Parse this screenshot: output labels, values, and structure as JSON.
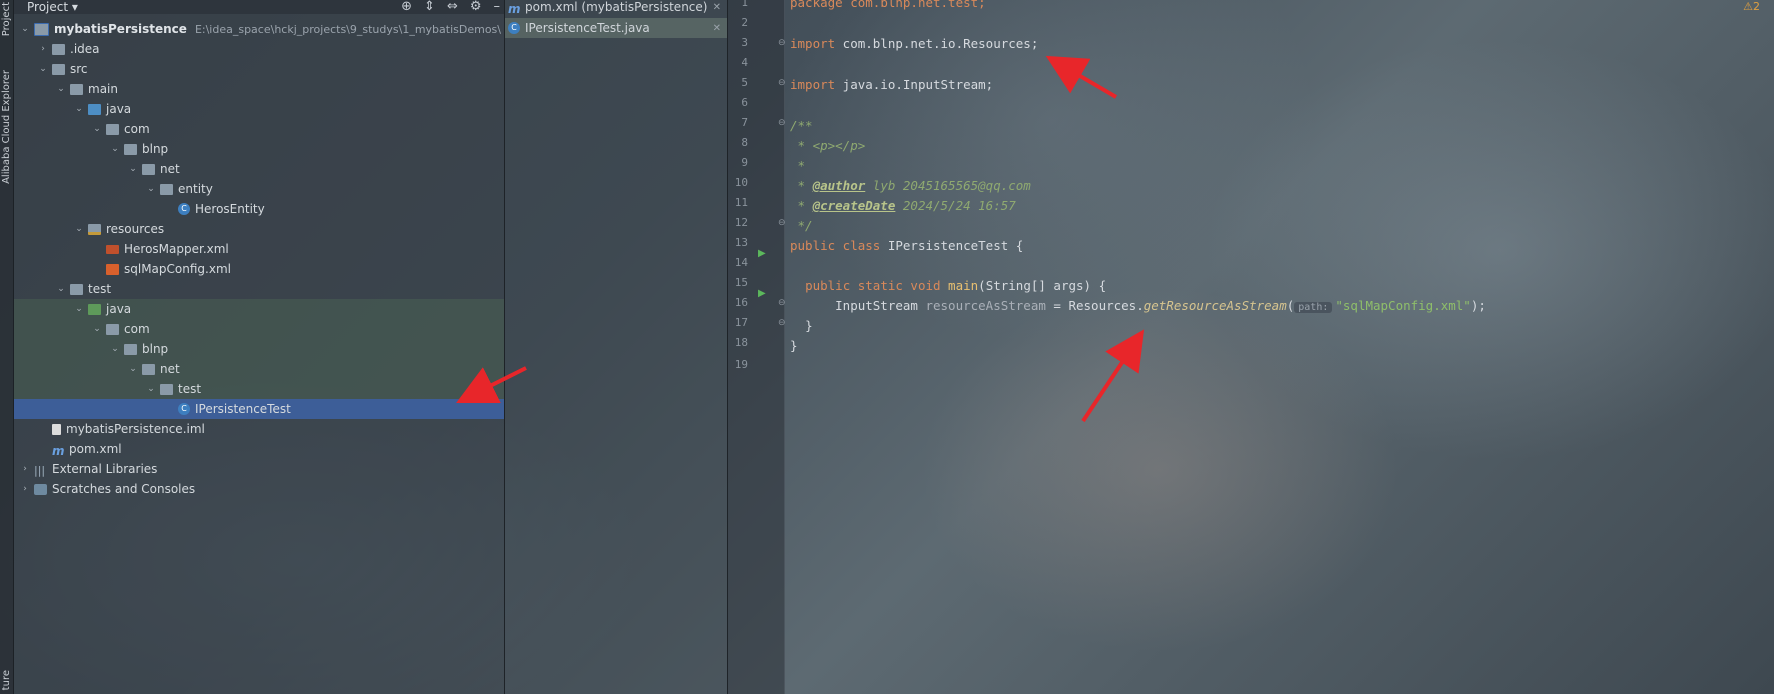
{
  "toolstrip": {
    "project_label": "Project",
    "cloud_label": "Alibaba Cloud Explorer",
    "structure_label": "ture"
  },
  "project_panel": {
    "title": "Project",
    "tree": [
      {
        "label": "mybatisPersistence",
        "hint": "E:\\idea_space\\hckj_projects\\9_studys\\1_mybatisDemos\\",
        "icon": "module-folder-icon",
        "expanded": true
      },
      {
        "label": ".idea",
        "icon": "folder-icon",
        "expanded": false
      },
      {
        "label": "src",
        "icon": "folder-icon",
        "expanded": true
      },
      {
        "label": "main",
        "icon": "folder-icon",
        "expanded": true
      },
      {
        "label": "java",
        "icon": "source-folder-icon",
        "expanded": true
      },
      {
        "label": "com",
        "icon": "package-icon",
        "expanded": true
      },
      {
        "label": "blnp",
        "icon": "package-icon",
        "expanded": true
      },
      {
        "label": "net",
        "icon": "package-icon",
        "expanded": true
      },
      {
        "label": "entity",
        "icon": "package-icon",
        "expanded": true
      },
      {
        "label": "HerosEntity",
        "icon": "class-icon"
      },
      {
        "label": "resources",
        "icon": "resources-folder-icon",
        "expanded": true
      },
      {
        "label": "HerosMapper.xml",
        "icon": "mybatis-xml-icon"
      },
      {
        "label": "sqlMapConfig.xml",
        "icon": "xml-file-icon"
      },
      {
        "label": "test",
        "icon": "folder-icon",
        "expanded": true
      },
      {
        "label": "java",
        "icon": "test-source-folder-icon",
        "expanded": true
      },
      {
        "label": "com",
        "icon": "package-icon",
        "expanded": true
      },
      {
        "label": "blnp",
        "icon": "package-icon",
        "expanded": true
      },
      {
        "label": "net",
        "icon": "package-icon",
        "expanded": true
      },
      {
        "label": "test",
        "icon": "package-icon",
        "expanded": true
      },
      {
        "label": "IPersistenceTest",
        "icon": "class-icon",
        "selected": true
      },
      {
        "label": "mybatisPersistence.iml",
        "icon": "iml-file-icon"
      },
      {
        "label": "pom.xml",
        "icon": "maven-icon"
      },
      {
        "label": "External Libraries",
        "icon": "library-icon",
        "expanded": false
      },
      {
        "label": "Scratches and Consoles",
        "icon": "scratch-icon",
        "expanded": false
      }
    ]
  },
  "open_files": [
    {
      "label": "pom.xml (mybatisPersistence)",
      "icon": "maven-icon"
    },
    {
      "label": "IPersistenceTest.java",
      "icon": "class-icon",
      "active": true
    }
  ],
  "editor": {
    "warnings": "2",
    "lines": [
      "1",
      "2",
      "3",
      "4",
      "5",
      "6",
      "7",
      "8",
      "9",
      "10",
      "11",
      "12",
      "13",
      "14",
      "15",
      "16",
      "17",
      "18",
      "19"
    ],
    "code": {
      "l1_kw": "package",
      "l1_rest": " com.blnp.net.test;",
      "l3_kw": "import",
      "l3_rest": " com.blnp.net.io.Resources;",
      "l5_kw": "import",
      "l5_rest": " java.io.InputStream;",
      "l7": "/**",
      "l8_star": " * ",
      "l8_text": "<p></p>",
      "l9": " *",
      "l10_star": " * ",
      "l10_tag": "@author",
      "l10_text": " lyb 2045165565@qq.com",
      "l11_star": " * ",
      "l11_tag": "@createDate",
      "l11_text": " 2024/5/24 16:57",
      "l12": " */",
      "l13_kw": "public class",
      "l13_rest": " IPersistenceTest {",
      "l15_kw": "public static void",
      "l15_fn": " main",
      "l15_rest": "(String[] args) {",
      "l16_type": "InputStream ",
      "l16_var": "resourceAsStream",
      "l16_eq": " = Resources.",
      "l16_call": "getResourceAsStream",
      "l16_paren": "(",
      "l16_hint": "path:",
      "l16_str": "\"sqlMapConfig.xml\"",
      "l16_end": ");",
      "l17": "}",
      "l18": "}"
    }
  },
  "colors": {
    "selection": "#3d5e98",
    "keyword": "#d9895a",
    "string": "#8fbf6a",
    "annotation_arrow": "#e8262a"
  }
}
